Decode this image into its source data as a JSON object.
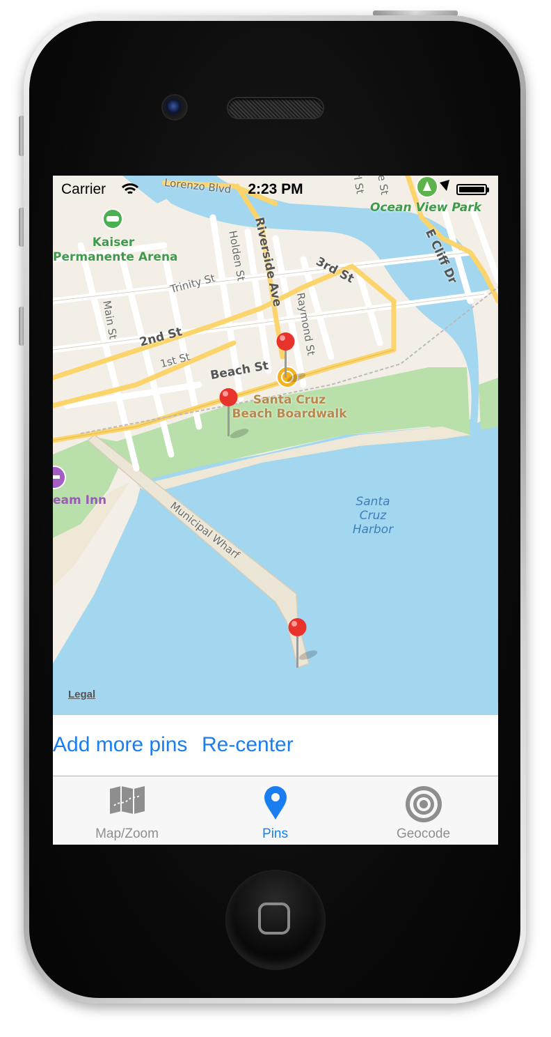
{
  "status_bar": {
    "carrier": "Carrier",
    "time": "2:23 PM"
  },
  "map": {
    "streets": {
      "lorenzo_blvd": "Lorenzo Blvd",
      "riverside_ave": "Riverside Ave",
      "holden_st": "Holden St",
      "third_st": "3rd St",
      "trinity_st": "Trinity St",
      "raymond_st": "Raymond St",
      "main_st": "Main St",
      "second_st": "2nd St",
      "first_st": "1st St",
      "beach_st": "Beach St",
      "e_cliff_dr": "E Cliff Dr",
      "municipal_wharf": "Municipal Wharf",
      "partial_st_1": "rl St",
      "partial_st_2": "e St"
    },
    "pois": {
      "kaiser": "Kaiser\nPermanente Arena",
      "ocean_view_park": "Ocean View Park",
      "boardwalk": "Santa Cruz\nBeach Boardwalk",
      "dream_inn": "eam Inn",
      "harbor": "Santa\nCruz\nHarbor"
    },
    "legal": "Legal",
    "pins_count": 3
  },
  "controls": {
    "add_pins_label": "Add more pins",
    "recenter_label": "Re-center"
  },
  "tabs": [
    {
      "label": "Map/Zoom",
      "icon": "map-icon",
      "active": false
    },
    {
      "label": "Pins",
      "icon": "pin-icon",
      "active": true
    },
    {
      "label": "Geocode",
      "icon": "target-icon",
      "active": false
    }
  ],
  "colors": {
    "accent": "#1a7ef0",
    "water": "#a3d6ef",
    "land": "#f3efe6",
    "park": "#b9dfaa",
    "road": "#fcd46c",
    "pin": "#e8332d"
  }
}
